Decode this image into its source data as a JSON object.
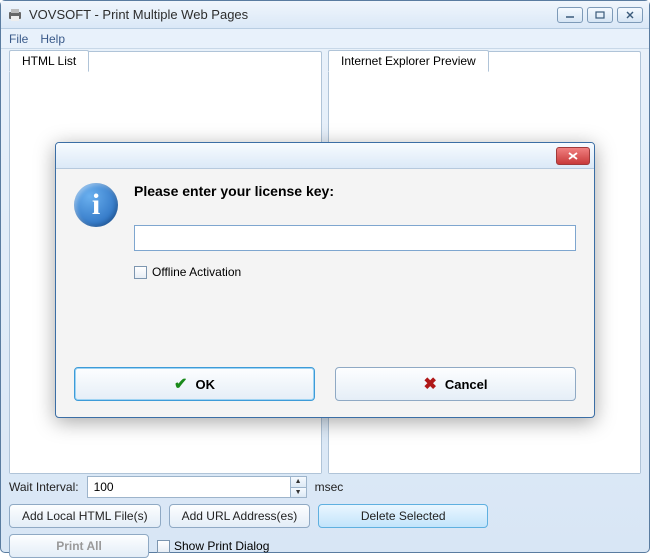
{
  "window": {
    "title": "VOVSOFT - Print Multiple Web Pages"
  },
  "menu": {
    "file": "File",
    "help": "Help"
  },
  "tabs": {
    "html_list": "HTML List",
    "ie_preview": "Internet Explorer Preview"
  },
  "bottom": {
    "wait_label": "Wait Interval:",
    "wait_value": "100",
    "wait_unit": "msec",
    "add_local": "Add Local HTML File(s)",
    "add_url": "Add URL Address(es)",
    "delete_selected": "Delete Selected",
    "print_all": "Print All",
    "show_print_dialog": "Show Print Dialog"
  },
  "dialog": {
    "heading": "Please enter your license key:",
    "input_value": "",
    "offline_activation": "Offline Activation",
    "ok": "OK",
    "cancel": "Cancel"
  }
}
